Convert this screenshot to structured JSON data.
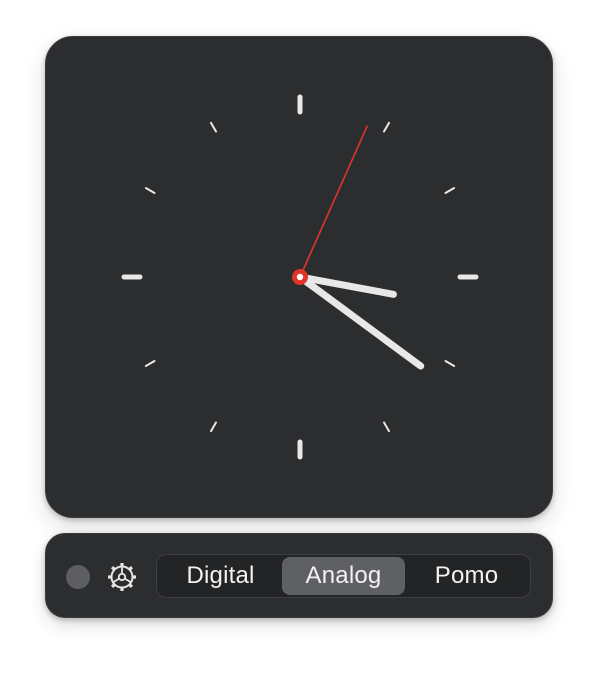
{
  "clock": {
    "face": "analog",
    "time": {
      "hours": 3,
      "minutes": 21,
      "seconds": 4
    },
    "colors": {
      "background": "#2c2d2f",
      "hands": "#e8e8e8",
      "second_hand": "#e0352b",
      "ticks": "#e8e8e8"
    }
  },
  "toolbar": {
    "status_dot_color": "#5d5e61",
    "settings_icon": "gear-icon",
    "modes": [
      {
        "label": "Digital",
        "selected": false
      },
      {
        "label": "Analog",
        "selected": true
      },
      {
        "label": "Pomo",
        "selected": false
      }
    ]
  }
}
